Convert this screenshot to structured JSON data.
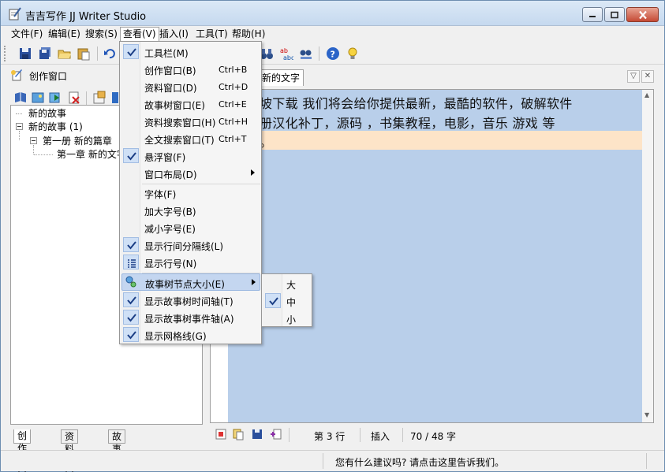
{
  "window": {
    "title": "吉吉写作 JJ Writer Studio"
  },
  "menubar": {
    "items": [
      "文件(F)",
      "编辑(E)",
      "搜索(S)",
      "查看(V)",
      "插入(I)",
      "工具(T)",
      "帮助(H)"
    ],
    "active_index": 3
  },
  "left_panel": {
    "title": "创作窗口",
    "tree": {
      "root1": "新的故事",
      "root2": "新的故事 (1)",
      "volume": "第一册 新的篇章",
      "chapter": "第一章 新的文字"
    },
    "tabs": [
      "创作窗口",
      "资料窗口",
      "故事树"
    ]
  },
  "editor": {
    "tab_label": "新的文字",
    "lines": [
      "坡下载   我们将会给你提供最新，最酷的软件，破解软件",
      "册汉化补丁，源码  ，书集教程，电影，音乐   游戏   等",
      "。"
    ]
  },
  "status": {
    "line": "第 3 行",
    "mode": "插入",
    "count": "70 / 48 字"
  },
  "app_status": {
    "message": "您有什么建议吗? 请点击这里告诉我们。"
  },
  "view_menu": {
    "items": [
      {
        "label": "工具栏(M)",
        "shortcut": "",
        "checked": true
      },
      {
        "label": "创作窗口(B)",
        "shortcut": "Ctrl+B",
        "checked": false
      },
      {
        "label": "资料窗口(D)",
        "shortcut": "Ctrl+D",
        "checked": false
      },
      {
        "label": "故事树窗口(E)",
        "shortcut": "Ctrl+E",
        "checked": false
      },
      {
        "label": "资料搜索窗口(H)",
        "shortcut": "Ctrl+H",
        "checked": false
      },
      {
        "label": "全文搜索窗口(T)",
        "shortcut": "Ctrl+T",
        "checked": false
      },
      {
        "label": "悬浮窗(F)",
        "shortcut": "",
        "checked": true
      },
      {
        "label": "窗口布局(D)",
        "shortcut": "",
        "checked": false,
        "submenu": true
      },
      {
        "label": "字体(F)",
        "shortcut": "",
        "checked": false
      },
      {
        "label": "加大字号(B)",
        "shortcut": "",
        "checked": false
      },
      {
        "label": "减小字号(E)",
        "shortcut": "",
        "checked": false
      },
      {
        "label": "显示行间分隔线(L)",
        "shortcut": "",
        "checked": true
      },
      {
        "label": "显示行号(N)",
        "shortcut": "",
        "checked": false
      },
      {
        "label": "故事树节点大小(E)",
        "shortcut": "",
        "checked": false,
        "submenu": true,
        "highlighted": true
      },
      {
        "label": "显示故事树时间轴(T)",
        "shortcut": "",
        "checked": true
      },
      {
        "label": "显示故事树事件轴(A)",
        "shortcut": "",
        "checked": true
      },
      {
        "label": "显示网格线(G)",
        "shortcut": "",
        "checked": true
      }
    ]
  },
  "submenu": {
    "items": [
      {
        "label": "大",
        "checked": false
      },
      {
        "label": "中",
        "checked": true
      },
      {
        "label": "小",
        "checked": false
      }
    ]
  },
  "icons": {
    "check": "check-icon",
    "app": "notepad-pen-icon"
  }
}
